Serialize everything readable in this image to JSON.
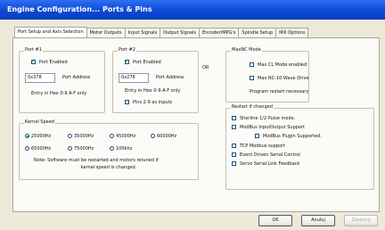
{
  "window": {
    "title": "Engine Configuration... Ports & Pins"
  },
  "tabs": [
    "Port Setup and Axis Selection",
    "Motor Outputs",
    "Input Signals",
    "Output Signals",
    "Encoder/MPG's",
    "Spindle Setup",
    "Mill Options"
  ],
  "port1": {
    "title": "Port #1",
    "enabled_label": "Port Enabled",
    "enabled": true,
    "address_value": "0x378",
    "address_label": "Port Address",
    "hint": "Entry in Hex 0-9 A-F only"
  },
  "or_label": "OR",
  "port2": {
    "title": "Port #2",
    "enabled_label": "Port Enabled",
    "enabled": true,
    "address_value": "0x278",
    "address_label": "Port Address",
    "hint": "Entry in Hex 0-9 A-F only",
    "pins_label": "Pins 2-9 as inputs",
    "pins_checked": false
  },
  "maxnc": {
    "title": "MaxNC Mode",
    "cl_label": "Max CL Mode enabled",
    "nc10_label": "Max NC-10 Wave Drive",
    "note": "Program restart necessary"
  },
  "kernel": {
    "title": "Kernel Speed",
    "speeds": [
      "25000Hz",
      "35000Hz",
      "45000Hz",
      "60000Hz",
      "65000Hz",
      "75000Hz",
      "100khz"
    ],
    "selected_index": 0,
    "note_line1": "Note: Software must be restarted and motors retuned if",
    "note_line2": "kernel speed is changed."
  },
  "restart": {
    "title": "Restart if changed",
    "options": [
      "Sherline 1/2 Pulse mode.",
      "ModBus InputOutput Support",
      "ModBus Plugin Supported.",
      "TCP Modbus support",
      "Event Driven Serial Control",
      "Servo Serial Link Feedback"
    ]
  },
  "buttons": {
    "ok": "OK",
    "apply": "Anuluj",
    "disabled": "Zastosuj"
  },
  "colors": {
    "titlebar": "#0a48d6",
    "check": "#218d2b",
    "face": "#ece9d8"
  }
}
